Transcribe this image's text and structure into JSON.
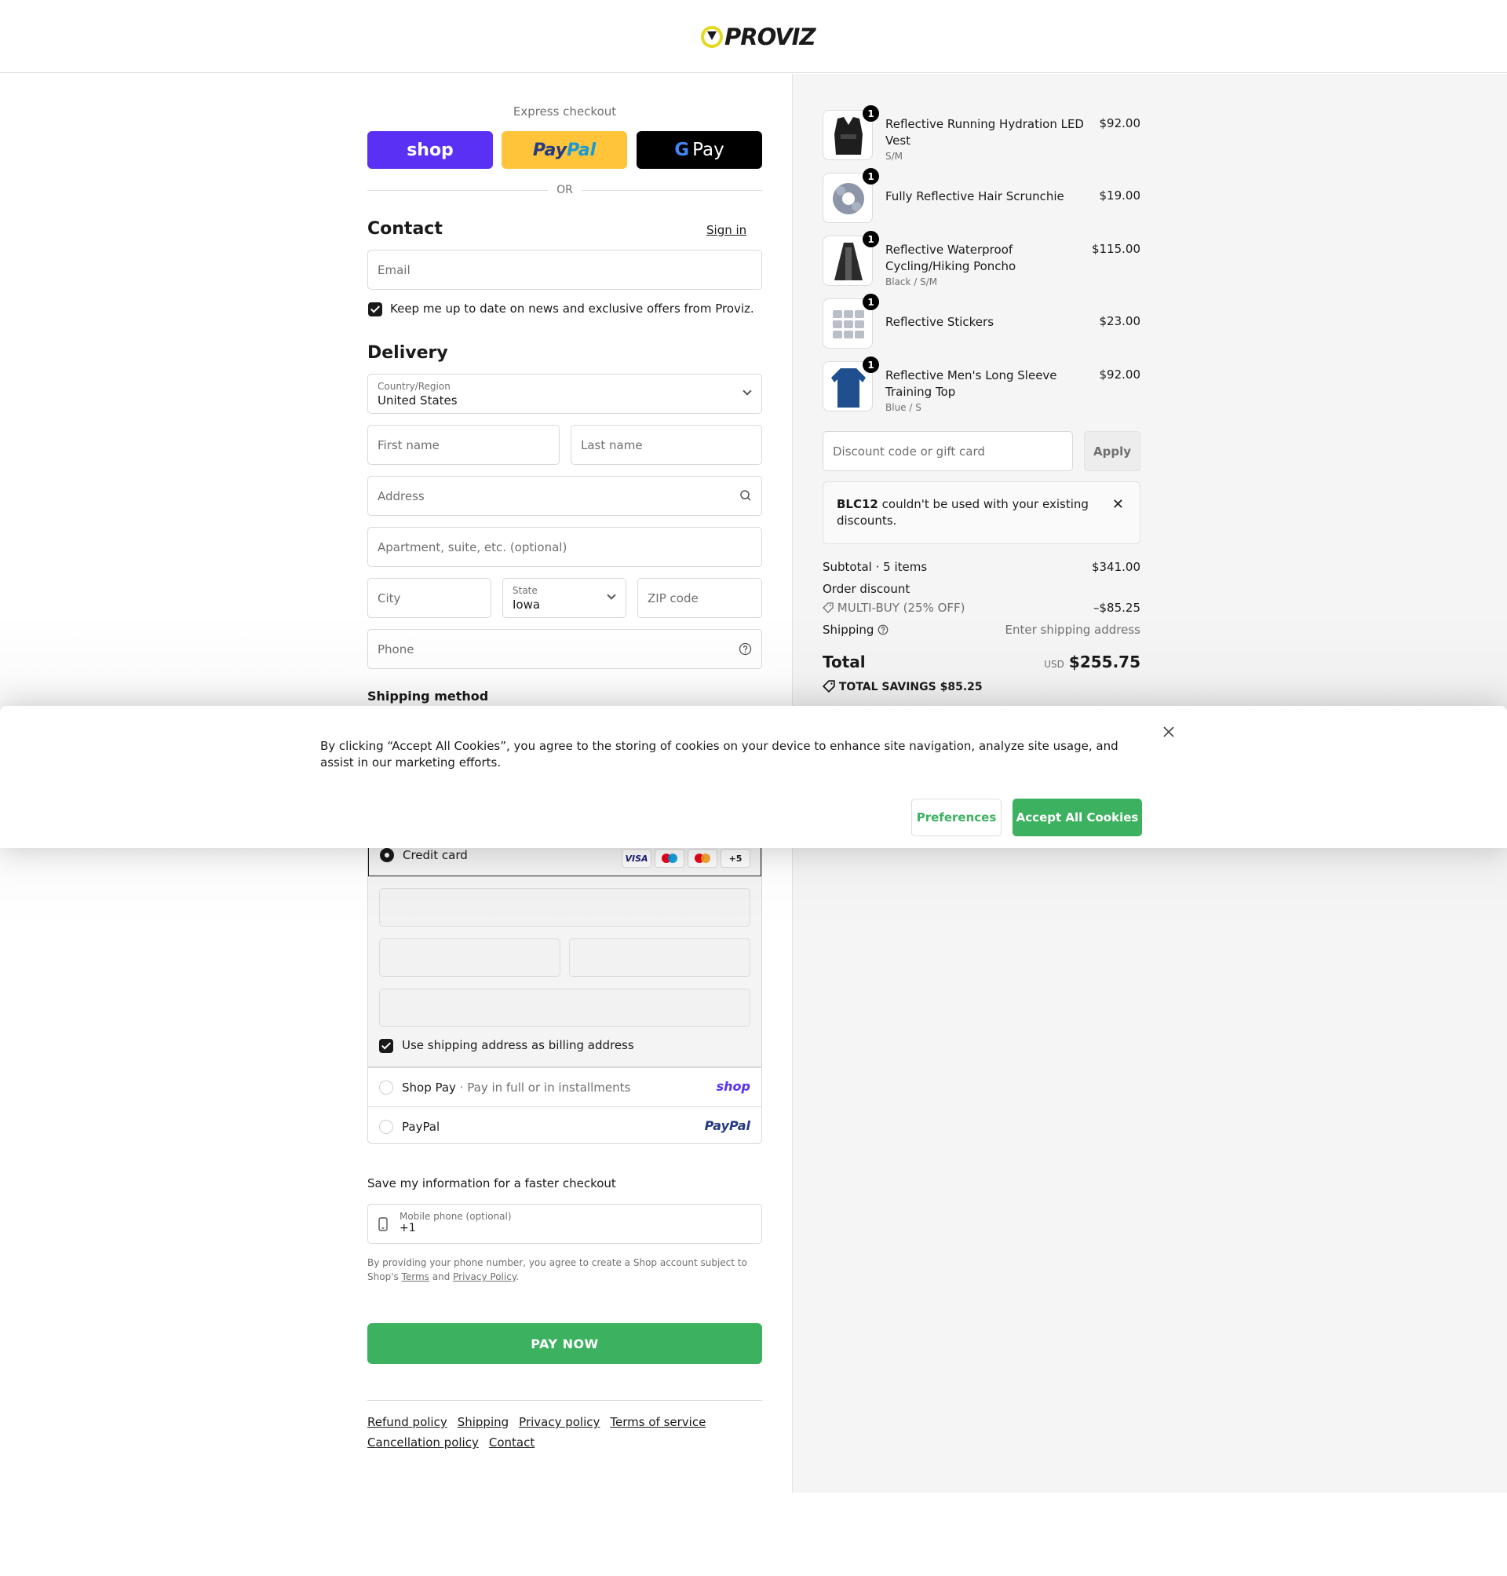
{
  "brand": {
    "name": "PROVIZ"
  },
  "express": {
    "label": "Express checkout",
    "shop": "shop",
    "paypal_a": "Pay",
    "paypal_b": "Pal",
    "gpay_g": "G",
    "gpay_text": "Pay",
    "or": "OR"
  },
  "contact": {
    "title": "Contact",
    "sign_in": "Sign in",
    "email_placeholder": "Email",
    "newsletter": "Keep me up to date on news and exclusive offers from Proviz."
  },
  "delivery": {
    "title": "Delivery",
    "country_label": "Country/Region",
    "country_value": "United States",
    "first_name": "First name",
    "last_name": "Last name",
    "address": "Address",
    "apartment": "Apartment, suite, etc. (optional)",
    "city": "City",
    "state_label": "State",
    "state_value": "Iowa",
    "zip": "ZIP code",
    "phone": "Phone"
  },
  "shipping_method": {
    "title": "Shipping method"
  },
  "payment": {
    "credit_card": "Credit card",
    "cards": [
      "VISA",
      "",
      "",
      "+5"
    ],
    "billing_same": "Use shipping address as billing address",
    "shop_pay": "Shop Pay",
    "shop_pay_sub": "· Pay in full or in installments",
    "shop_pay_brand": "shop",
    "paypal": "PayPal",
    "paypal_brand": "PayPal"
  },
  "save_info": {
    "label": "Save my information for a faster checkout",
    "mobile_label": "Mobile phone (optional)",
    "mobile_value": "+1",
    "fine_a": "By providing your phone number, you agree to create a Shop account subject to Shop's",
    "terms": "Terms",
    "and": "and",
    "privacy": "Privacy Policy",
    "period": "."
  },
  "pay_now": "PAY NOW",
  "footer": {
    "links": [
      "Refund policy",
      "Shipping",
      "Privacy policy",
      "Terms of service",
      "Cancellation policy",
      "Contact"
    ]
  },
  "order": {
    "items": [
      {
        "name": "Reflective Running Hydration LED Vest",
        "variant": "S/M",
        "price": "$92.00",
        "qty": "1"
      },
      {
        "name": "Fully Reflective Hair Scrunchie",
        "variant": "",
        "price": "$19.00",
        "qty": "1"
      },
      {
        "name": "Reflective Waterproof Cycling/Hiking Poncho",
        "variant": "Black / S/M",
        "price": "$115.00",
        "qty": "1"
      },
      {
        "name": "Reflective Stickers",
        "variant": "",
        "price": "$23.00",
        "qty": "1"
      },
      {
        "name": "Reflective Men's Long Sleeve Training Top",
        "variant": "Blue / S",
        "price": "$92.00",
        "qty": "1"
      }
    ],
    "discount_placeholder": "Discount code or gift card",
    "apply": "Apply",
    "notice_code": "BLC12",
    "notice_text": " couldn't be used with your existing discounts.",
    "subtotal_label": "Subtotal · 5 items",
    "subtotal_value": "$341.00",
    "order_discount": "Order discount",
    "discount_code": "MULTI-BUY (25% OFF)",
    "discount_value": "–$85.25",
    "shipping_label": "Shipping",
    "shipping_value": "Enter shipping address",
    "total_label": "Total",
    "currency": "USD",
    "total_value": "$255.75",
    "savings_label": "TOTAL SAVINGS",
    "savings_value": "$85.25"
  },
  "cookie": {
    "text": "By clicking “Accept All Cookies”, you agree to the storing of cookies on your device to enhance site navigation, analyze site usage, and assist in our marketing efforts.",
    "preferences": "Preferences",
    "accept": "Accept All Cookies"
  }
}
